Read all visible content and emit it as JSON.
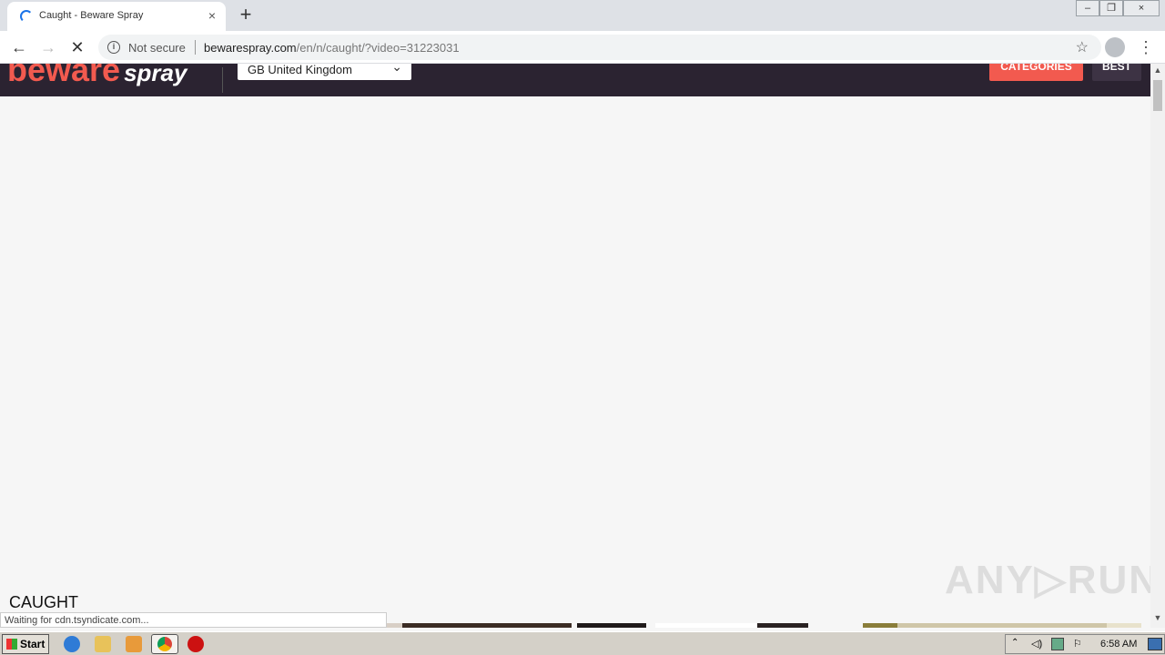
{
  "browser": {
    "tab_title": "Caught - Beware Spray",
    "tab_close": "×",
    "new_tab": "+",
    "win_minimize": "–",
    "win_restore": "❐",
    "win_close": "×",
    "back": "←",
    "forward": "→",
    "reload_stop": "✕",
    "info_glyph": "i",
    "security_label": "Not secure",
    "url_host": "bewarespray.com",
    "url_path": "/en/n/caught/?video=31223031",
    "star": "☆",
    "menu": "⋮"
  },
  "site": {
    "logo_text": "beware",
    "logo_text_2": "spray",
    "country_select": "GB United Kingdom",
    "country_chevron": "⌄",
    "nav": {
      "categories": "CATEGORIES",
      "best": "BEST"
    },
    "section_title": "CAUGHT"
  },
  "status_text": "Waiting for cdn.tsyndicate.com...",
  "watermark": "ANY▷RUN",
  "scroll": {
    "up": "▲",
    "down": "▼"
  },
  "taskbar": {
    "start_label": "Start",
    "clock": "6:58 AM"
  },
  "colors": {
    "site_header_bg": "#2b2331",
    "brand_red": "#f25a4f",
    "page_bg": "#f6f6f6"
  }
}
